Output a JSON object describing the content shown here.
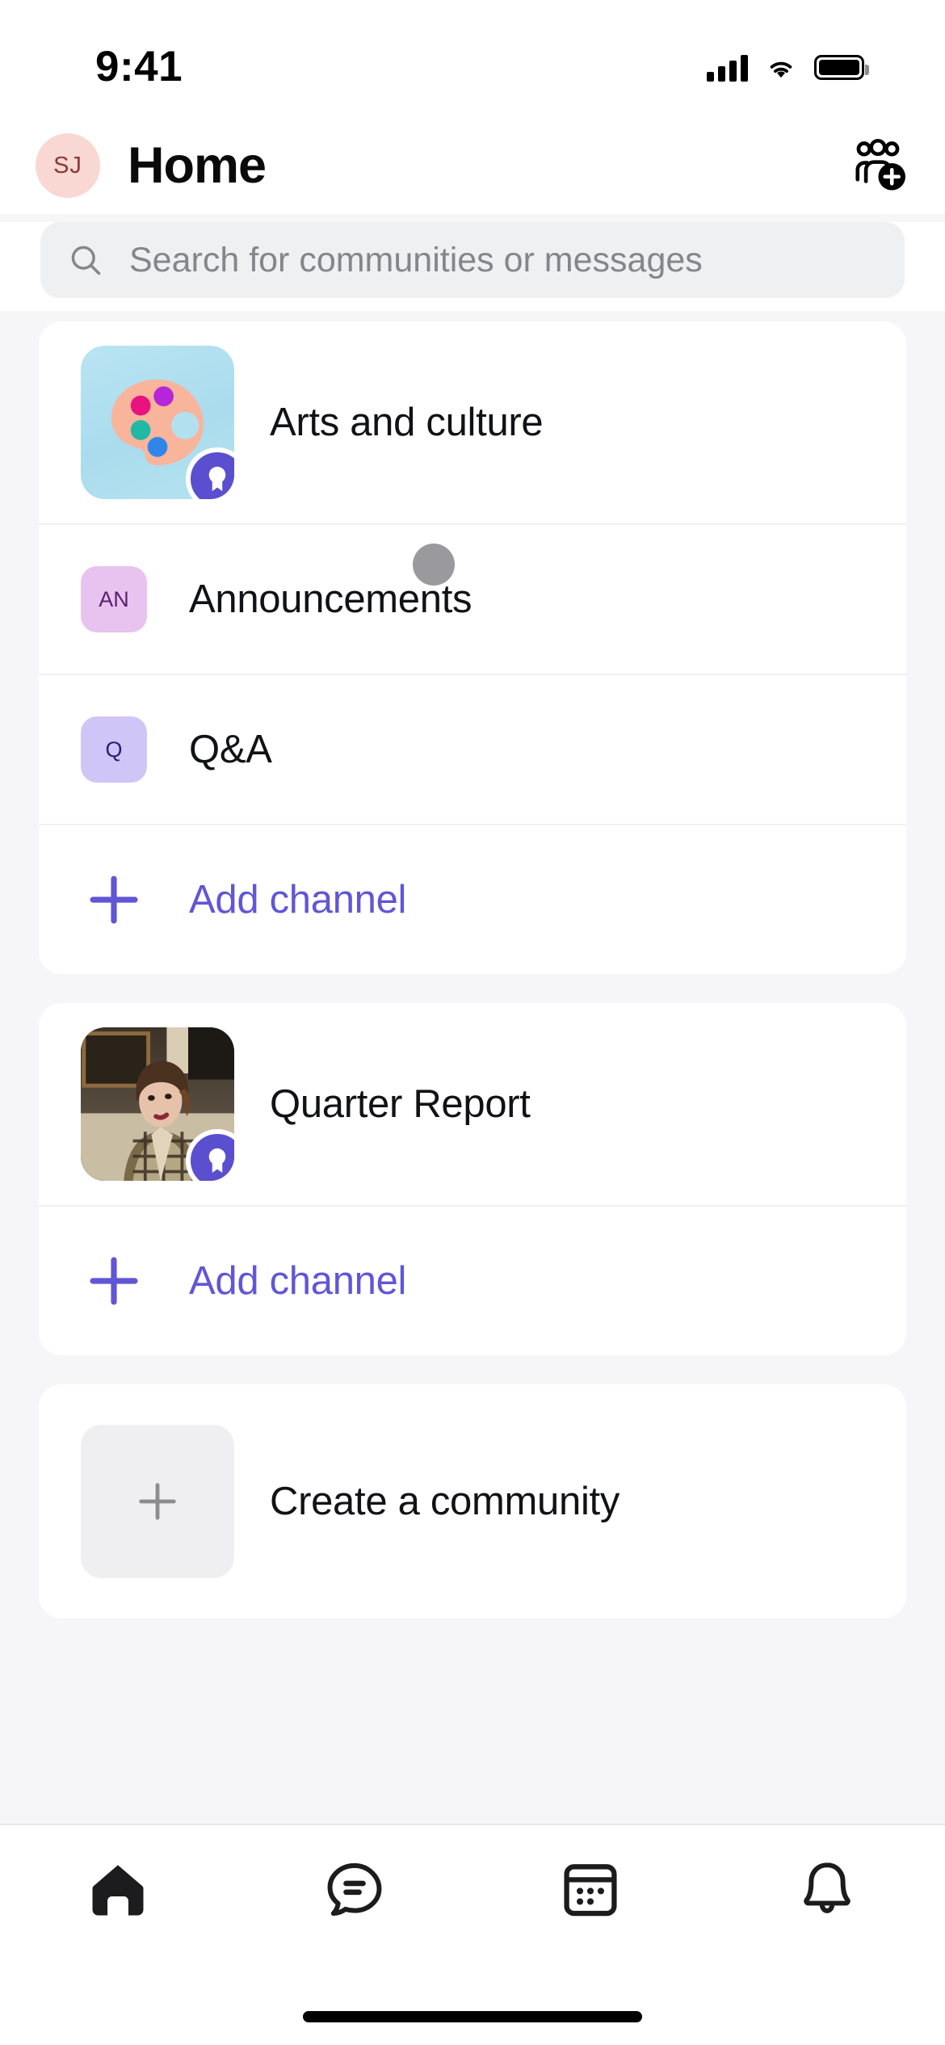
{
  "status_bar": {
    "time": "9:41",
    "signal_icon": "cellular-signal-icon",
    "wifi_icon": "wifi-icon",
    "battery_icon": "battery-full-icon"
  },
  "header": {
    "avatar_initials": "SJ",
    "avatar_bg": "#f9d7d3",
    "avatar_text_color": "#8a3a36",
    "title": "Home",
    "action_icon": "add-people-icon"
  },
  "search": {
    "placeholder": "Search for communities or messages",
    "icon": "search-icon",
    "value": ""
  },
  "accent_color": "#6056d6",
  "communities": [
    {
      "name": "Arts and culture",
      "avatar_type": "art-palette-illustration",
      "avatar_bg": "#b3e0ef",
      "badge_icon": "award-badge-icon",
      "badge_color": "#5a4fcf",
      "channels": [
        {
          "initials": "AN",
          "name": "Announcements",
          "badge_bg": "#e8c3ef",
          "badge_text_color": "#5a1f73"
        },
        {
          "initials": "Q",
          "name": "Q&A",
          "badge_bg": "#cfc6f7",
          "badge_text_color": "#2e1e6e"
        }
      ],
      "add_channel_label": "Add channel",
      "add_channel_icon": "plus-icon"
    },
    {
      "name": "Quarter Report",
      "avatar_type": "photo-thumbnail",
      "badge_icon": "award-badge-icon",
      "badge_color": "#5a4fcf",
      "channels": [],
      "add_channel_label": "Add channel",
      "add_channel_icon": "plus-icon"
    }
  ],
  "create_community": {
    "label": "Create a community",
    "icon": "plus-icon"
  },
  "tab_bar": {
    "items": [
      {
        "icon": "home-icon",
        "active": true
      },
      {
        "icon": "chat-bubble-icon",
        "active": false
      },
      {
        "icon": "calendar-icon",
        "active": false
      },
      {
        "icon": "bell-icon",
        "active": false
      }
    ]
  },
  "cursor": {
    "icon": "touch-indicator"
  }
}
